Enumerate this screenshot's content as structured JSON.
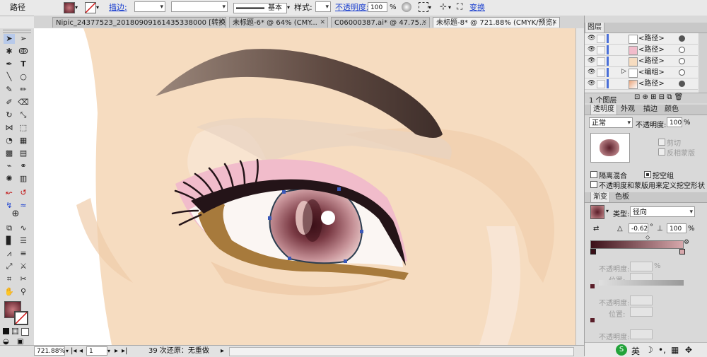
{
  "control_bar": {
    "object_type": "路径",
    "stroke_label": "描边:",
    "stroke_style": "基本",
    "style_label": "样式:",
    "opacity_label": "不透明度:",
    "opacity_value": "100",
    "opacity_unit": "%",
    "transform_label": "变换"
  },
  "tabs": [
    {
      "label": "Nipic_24377523_20180909161435338000 [转换].ai* @ ..."
    },
    {
      "label": "未标题-6* @ 64% (CMY..."
    },
    {
      "label": "C06000387.ai* @ 47.75..."
    },
    {
      "label": "未标题-8* @ 721.88% (CMYK/预览)"
    }
  ],
  "status_bar": {
    "zoom": "721.88%",
    "page": "1",
    "undo_text": "39 次还原：无重做"
  },
  "layers_panel": {
    "title": "图层",
    "rows": [
      {
        "name": "<路径>"
      },
      {
        "name": "<路径>"
      },
      {
        "name": "<路径>"
      },
      {
        "name": "<编组>"
      },
      {
        "name": "<路径>"
      }
    ],
    "footer": "1 个图层"
  },
  "transparency_panel": {
    "tabs": [
      "透明度",
      "外观",
      "描边",
      "颜色"
    ],
    "blend_mode": "正常",
    "opacity_label": "不透明度:",
    "opacity_value": "100",
    "opacity_unit": "%",
    "clip_label": "剪切",
    "invert_label": "反相蒙版",
    "isolate_label": "隔离混合",
    "knockout_label": "挖空组",
    "define_label": "不透明度和蒙版用来定义挖空形状"
  },
  "gradient_panel": {
    "tabs": [
      "渐变",
      "色板"
    ],
    "type_label": "类型:",
    "type_value": "径向",
    "angle_value": "-0.62",
    "angle_unit": "°",
    "ratio_value": "100",
    "ratio_unit": "%",
    "opacity_label": "不透明度:",
    "location_label": "位置:",
    "percent": "%"
  },
  "taskbar": {
    "ime_label": "英"
  },
  "colors": {
    "skin": "#f6dcc0",
    "iris_dark": "#6b2f3a",
    "eyeliner": "#241418",
    "brow": "#6f5a52",
    "pink_shadow": "#f1bccb",
    "selection": "#3a58b8"
  }
}
